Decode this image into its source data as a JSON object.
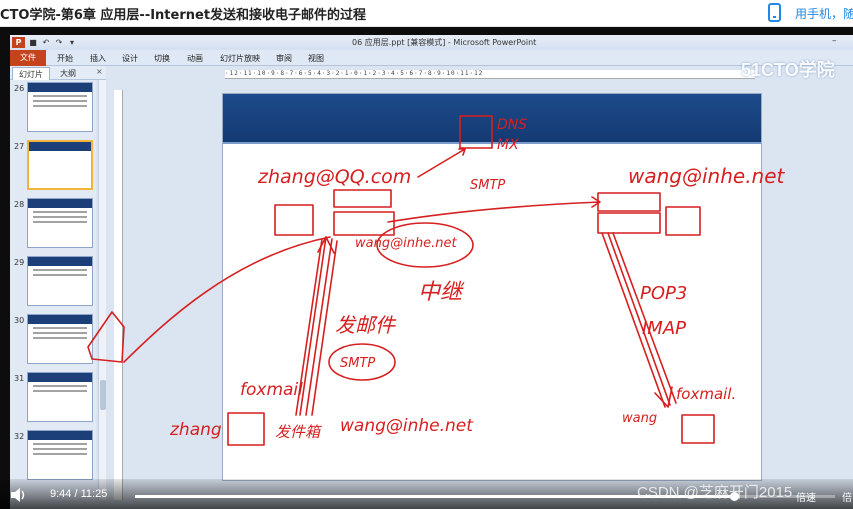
{
  "header": {
    "title": "CTO学院-第6章 应用层--Internet发送和接收电子邮件的过程",
    "mobile_link": "用手机，随"
  },
  "ppt": {
    "window_title": "06 应用层.ppt [兼容模式] - Microsoft PowerPoint",
    "ribbon_file": "文件",
    "ribbon_tabs": [
      "开始",
      "插入",
      "设计",
      "切换",
      "动画",
      "幻灯片放映",
      "审阅",
      "视图"
    ],
    "panel_tabs": [
      "幻灯片",
      "大纲"
    ],
    "slide_numbers": [
      "26",
      "27",
      "28",
      "29",
      "30",
      "31",
      "32"
    ],
    "watermark": "51CTO学院"
  },
  "annotations": {
    "dns_mx": [
      "DNS",
      "MX"
    ],
    "sender_address": "zhang@QQ.com",
    "receiver_address": "wang@inhe.net",
    "smtp_top": "SMTP",
    "relay": "中继",
    "relay_address": "wang@inhe.net",
    "send_mail": "发邮件",
    "smtp_circle": "SMTP",
    "pop3": "POP3",
    "imap": "IMAP",
    "client_left": "zhang",
    "foxmail_left": "foxmail",
    "outbox_bottom": "发件箱",
    "outbox_bottom_address": "wang@inhe.net",
    "client_right": "wang",
    "foxmail_right": "foxmail."
  },
  "player": {
    "current_time": "9:44",
    "separator": "/",
    "duration": "11:25",
    "progress": 0.855,
    "watermark": "CSDN @芝麻开门2015",
    "speed": "倍速",
    "ratio_label": "倍"
  }
}
